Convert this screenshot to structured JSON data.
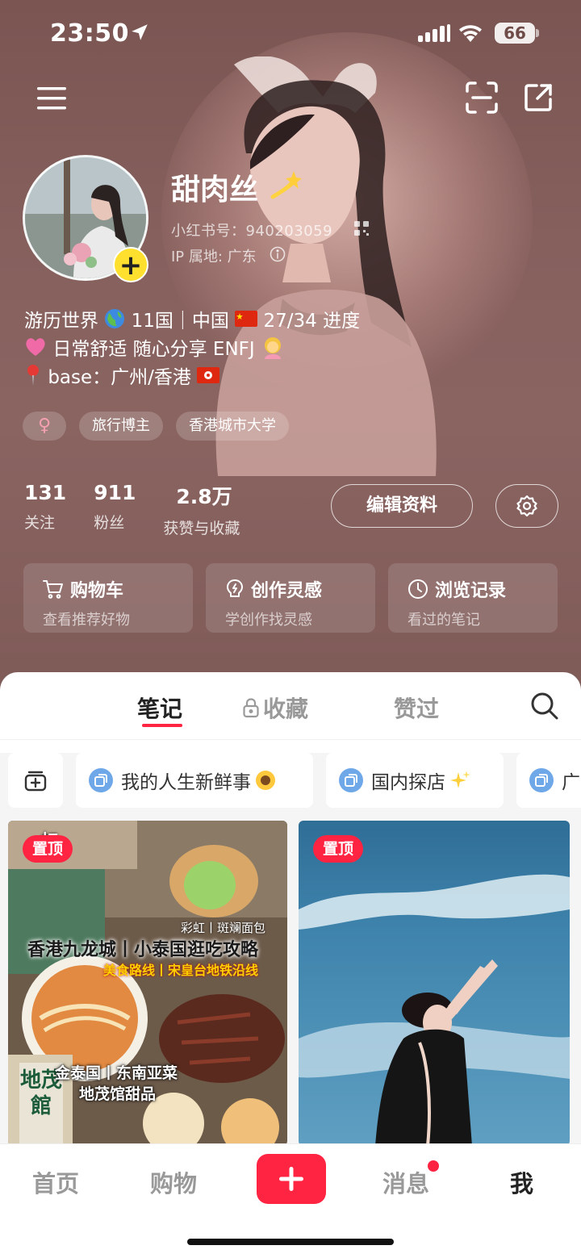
{
  "status_bar": {
    "time": "23:50",
    "battery": "66"
  },
  "profile": {
    "nickname": "甜肉丝",
    "red_id": "小红书号：940203059",
    "ip_location": "IP 属地: 广东",
    "bio": {
      "line1_a": "游历世界",
      "line1_b": "11国｜中国",
      "line1_c": "27/34 进度",
      "line2": "日常舒适 随心分享 ENFJ",
      "line3": "base：广州/香港"
    },
    "tags": [
      "旅行博主",
      "香港城市大学"
    ],
    "gender_symbol": "♀"
  },
  "stats": [
    {
      "value": "131",
      "label": "关注"
    },
    {
      "value": "911",
      "label": "粉丝"
    },
    {
      "value": "2.8万",
      "label": "获赞与收藏"
    }
  ],
  "actions": {
    "edit_profile": "编辑资料"
  },
  "quick_entries": [
    {
      "title": "购物车",
      "subtitle": "查看推荐好物",
      "icon": "cart-icon"
    },
    {
      "title": "创作灵感",
      "subtitle": "学创作找灵感",
      "icon": "bulb-icon"
    },
    {
      "title": "浏览记录",
      "subtitle": "看过的笔记",
      "icon": "clock-icon"
    }
  ],
  "tabs": {
    "notes": "笔记",
    "collections": "收藏",
    "liked": "赞过"
  },
  "collections": [
    "我的人生新鲜事",
    "国内探店",
    "广"
  ],
  "cards": [
    {
      "pin": "置顶",
      "title": "香港九龙城丨小泰国逛吃攻略",
      "subtitle": "美食路线丨宋皇台地铁沿线",
      "small": "彩虹丨斑斓面包",
      "footer1": "金泰国丨东南亚菜",
      "footer2": "地茂馆甜品",
      "sign_top": "虹",
      "sign_side": "地茂館"
    },
    {
      "pin": "置顶"
    }
  ],
  "bottom_nav": {
    "home": "首页",
    "shop": "购物",
    "messages": "消息",
    "me": "我"
  },
  "colors": {
    "accent": "#ff2442",
    "hero_bg": "#86605d"
  }
}
